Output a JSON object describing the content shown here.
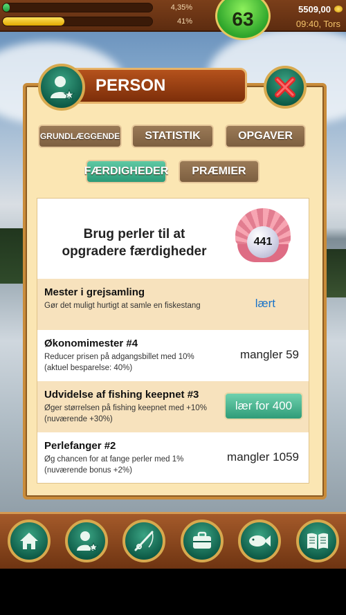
{
  "hud": {
    "xp_percent_text": "4,35%",
    "xp_fraction": 0.0435,
    "energy_percent_text": "41%",
    "energy_fraction": 0.41,
    "level": "63",
    "money": "5509,00",
    "clock": "09:40, Tors"
  },
  "panel": {
    "title": "PERSON",
    "tabs": [
      {
        "label": "GRUNDLÆGGENDE",
        "active": false
      },
      {
        "label": "STATISTIK",
        "active": false
      },
      {
        "label": "OPGAVER",
        "active": false
      },
      {
        "label": "FÆRDIGHEDER",
        "active": true
      },
      {
        "label": "PRÆMIER",
        "active": false
      }
    ],
    "pearl_prompt": "Brug perler til at opgradere færdigheder",
    "pearl_count": "441",
    "skills": [
      {
        "title": "Mester i grejsamling",
        "desc": "Gør det muligt hurtigt at samle en fiskestang",
        "status": "lært"
      },
      {
        "title": "Økonomimester #4",
        "desc": "Reducer prisen på adgangsbillet med 10% (aktuel besparelse: 40%)",
        "status": "mangler 59"
      },
      {
        "title": "Udvidelse af fishing keepnet #3",
        "desc": "Øger størrelsen på fishing keepnet med +10% (nuværende +30%)",
        "status": "lær for 400"
      },
      {
        "title": "Perlefanger #2",
        "desc": "Øg chancen for at fange perler med 1% (nuværende bonus +2%)",
        "status": "mangler 1059"
      }
    ]
  },
  "nav": {
    "icons": [
      "home-icon",
      "person-icon",
      "fishing-rod-icon",
      "briefcase-icon",
      "fish-icon",
      "book-icon"
    ]
  },
  "colors": {
    "wood": "#7c2e0a",
    "green_button": "#2f9c78",
    "panel_bg": "#fbe6b3",
    "learned_text": "#1a73c8"
  }
}
